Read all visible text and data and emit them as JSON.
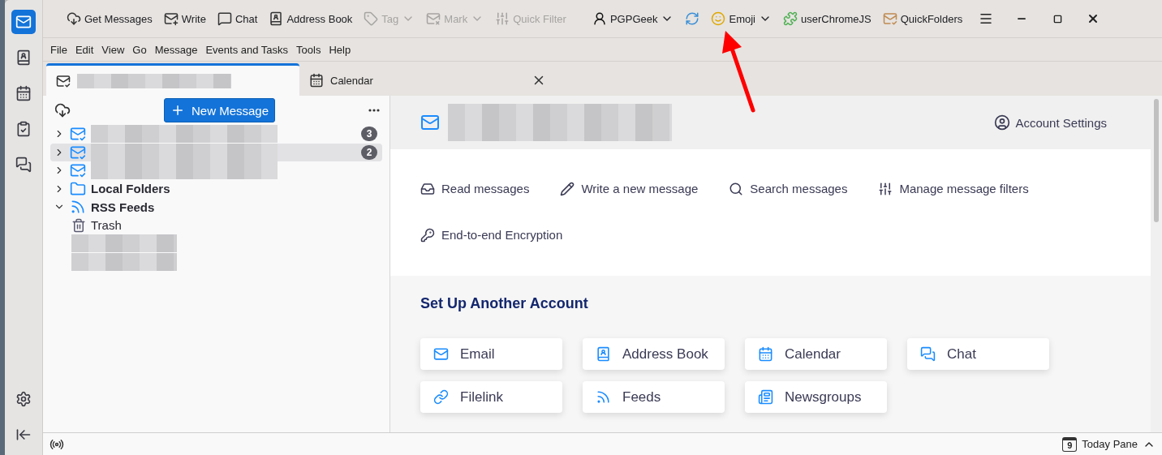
{
  "toolbar": {
    "items": [
      {
        "kind": "button",
        "label": "Get Messages",
        "disabled": false
      },
      {
        "kind": "button",
        "label": "Write",
        "disabled": false
      },
      {
        "kind": "button",
        "label": "Chat",
        "disabled": false
      },
      {
        "kind": "button",
        "label": "Address Book",
        "disabled": false
      },
      {
        "kind": "dropdown",
        "label": "Tag",
        "disabled": true
      },
      {
        "kind": "dropdown",
        "label": "Mark",
        "disabled": true
      },
      {
        "kind": "button",
        "label": "Quick Filter",
        "disabled": true
      },
      {
        "kind": "dropdown",
        "label": "PGPGeek",
        "disabled": false
      },
      {
        "kind": "icon",
        "disabled": false
      },
      {
        "kind": "dropdown",
        "label": "Emoji",
        "disabled": false
      },
      {
        "kind": "button",
        "label": "userChromeJS",
        "disabled": false
      },
      {
        "kind": "button",
        "label": "QuickFolders",
        "disabled": false
      }
    ]
  },
  "menubar": [
    "File",
    "Edit",
    "View",
    "Go",
    "Message",
    "Events and Tasks",
    "Tools",
    "Help"
  ],
  "tabs": [
    {
      "kind": "mail",
      "selected": true
    },
    {
      "kind": "calendar",
      "label": "Calendar",
      "selected": false
    }
  ],
  "folder_pane": {
    "new_message": "New Message",
    "folders": [
      {
        "kind": "account",
        "expanded": false,
        "selected": false,
        "count": "3"
      },
      {
        "kind": "account",
        "expanded": false,
        "selected": true,
        "count": "2"
      },
      {
        "kind": "account",
        "expanded": false,
        "selected": false
      },
      {
        "kind": "local",
        "label": "Local Folders",
        "expanded": false,
        "selected": false
      },
      {
        "kind": "rss",
        "label": "RSS Feeds",
        "expanded": true,
        "selected": false,
        "children": [
          {
            "kind": "trash",
            "label": "Trash",
            "selected": false
          },
          {
            "kind": "feed",
            "selected": false
          },
          {
            "kind": "feed",
            "selected": false
          }
        ]
      }
    ]
  },
  "account_hub": {
    "settings": "Account Settings",
    "actions": [
      "Read messages",
      "Write a new message",
      "Search messages",
      "Manage message filters",
      "End-to-end Encryption"
    ],
    "setup_title": "Set Up Another Account",
    "setup_cards": [
      "Email",
      "Address Book",
      "Calendar",
      "Chat",
      "Filelink",
      "Feeds",
      "Newsgroups"
    ]
  },
  "status_bar": {
    "today_day": "9",
    "today_pane": "Today Pane"
  }
}
